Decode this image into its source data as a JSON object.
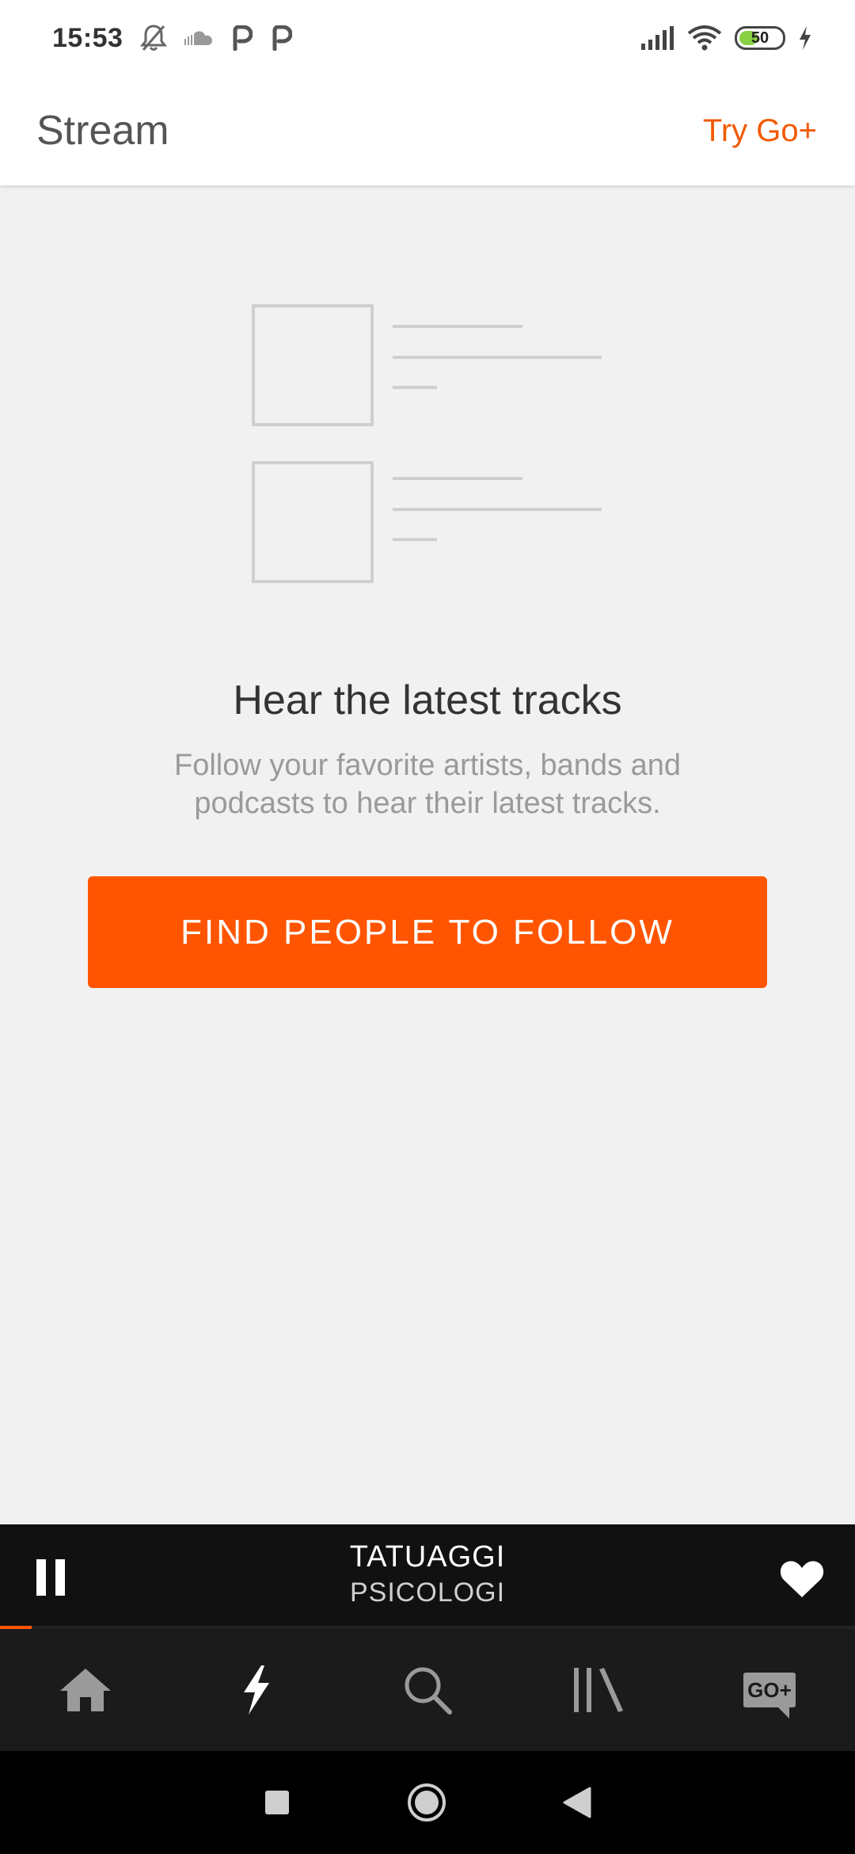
{
  "status_bar": {
    "time": "15:53",
    "battery_level": "50",
    "battery_fraction": 0.5,
    "icons": [
      "mute-icon",
      "soundcloud-icon",
      "p-icon",
      "p-icon",
      "signal-icon",
      "wifi-icon",
      "battery-icon",
      "charging-icon"
    ]
  },
  "app_bar": {
    "title": "Stream",
    "action": "Try Go+"
  },
  "empty_state": {
    "title": "Hear the latest tracks",
    "subtitle": "Follow your favorite artists, bands and podcasts to hear their latest tracks.",
    "button_label": "FIND PEOPLE TO FOLLOW"
  },
  "player": {
    "track_title": "TATUAGGI",
    "artist": "PSICOLOGI",
    "progress": 0.037,
    "state": "playing"
  },
  "bottom_nav": {
    "items": [
      {
        "name": "home",
        "icon": "home-icon"
      },
      {
        "name": "stream",
        "icon": "lightning-icon",
        "active": true
      },
      {
        "name": "search",
        "icon": "search-icon"
      },
      {
        "name": "library",
        "icon": "library-icon"
      },
      {
        "name": "go-plus",
        "icon": "go-plus-icon",
        "label": "GO+"
      }
    ]
  },
  "colors": {
    "accent": "#ff5500",
    "header_action": "#f15a00",
    "background": "#f1f1f1",
    "player_bg": "#111111",
    "nav_bg": "#1b1b1b",
    "nav_inactive": "#9a9a9a",
    "nav_active": "#ffffff"
  }
}
